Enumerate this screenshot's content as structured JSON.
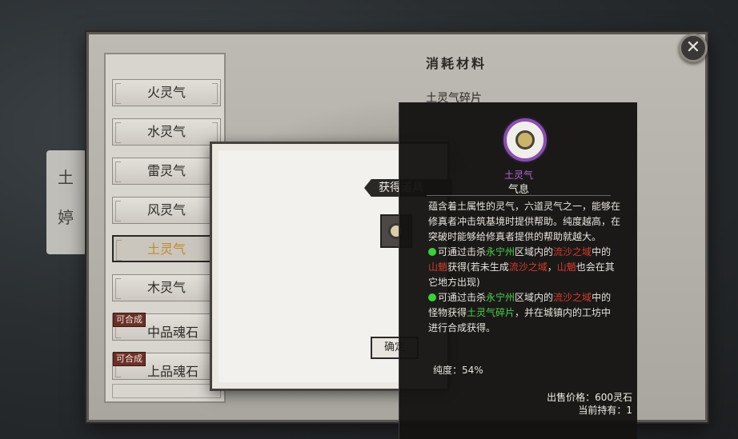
{
  "background": {
    "scroll_chars": [
      "土",
      "婷"
    ]
  },
  "close_label": "✕",
  "materials": {
    "items": [
      {
        "label": "火灵气"
      },
      {
        "label": "水灵气"
      },
      {
        "label": "雷灵气"
      },
      {
        "label": "风灵气"
      },
      {
        "label": "土灵气",
        "selected": true
      },
      {
        "label": "木灵气"
      },
      {
        "label": "中品魂石",
        "badge": "可合成"
      },
      {
        "label": "上品魂石",
        "badge": "可合成"
      }
    ]
  },
  "section": {
    "title": "消耗材料",
    "material_name": "土灵气碎片"
  },
  "dialog": {
    "gain_label": "获得道具",
    "confirm_label": "确定"
  },
  "tooltip": {
    "item_name": "土灵气",
    "item_type": "气息",
    "description": "蕴含着土属性的灵气，六道灵气之一，能够在修真者冲击筑基境时提供帮助。纯度越高，在突破时能够给修真者提供的帮助就越大。",
    "source1": {
      "prefix": "可通过击杀",
      "location": "永宁州",
      "mid": "区域内的",
      "area": "流沙之域",
      "mid2": "中的",
      "monster": "山魈",
      "suffix": "获得(若未生成",
      "area2": "流沙之域",
      "comma": "，",
      "monster2": "山魈",
      "tail": "也会在其它地方出现)"
    },
    "source2": {
      "prefix": "可通过击杀",
      "location": "永宁州",
      "mid": "区域内的",
      "area": "流沙之域",
      "mid2": "中的怪物获得",
      "fragment": "土灵气碎片",
      "tail": "，并在城镇内的工坊中进行合成获得。"
    },
    "purity": "纯度：54%",
    "price": "出售价格：600灵石",
    "holding": "当前持有：1"
  },
  "colors": {
    "purple": "#b667d9",
    "green": "#4fd14a",
    "red": "#d43a2c",
    "selected_text": "#c08a2c"
  }
}
